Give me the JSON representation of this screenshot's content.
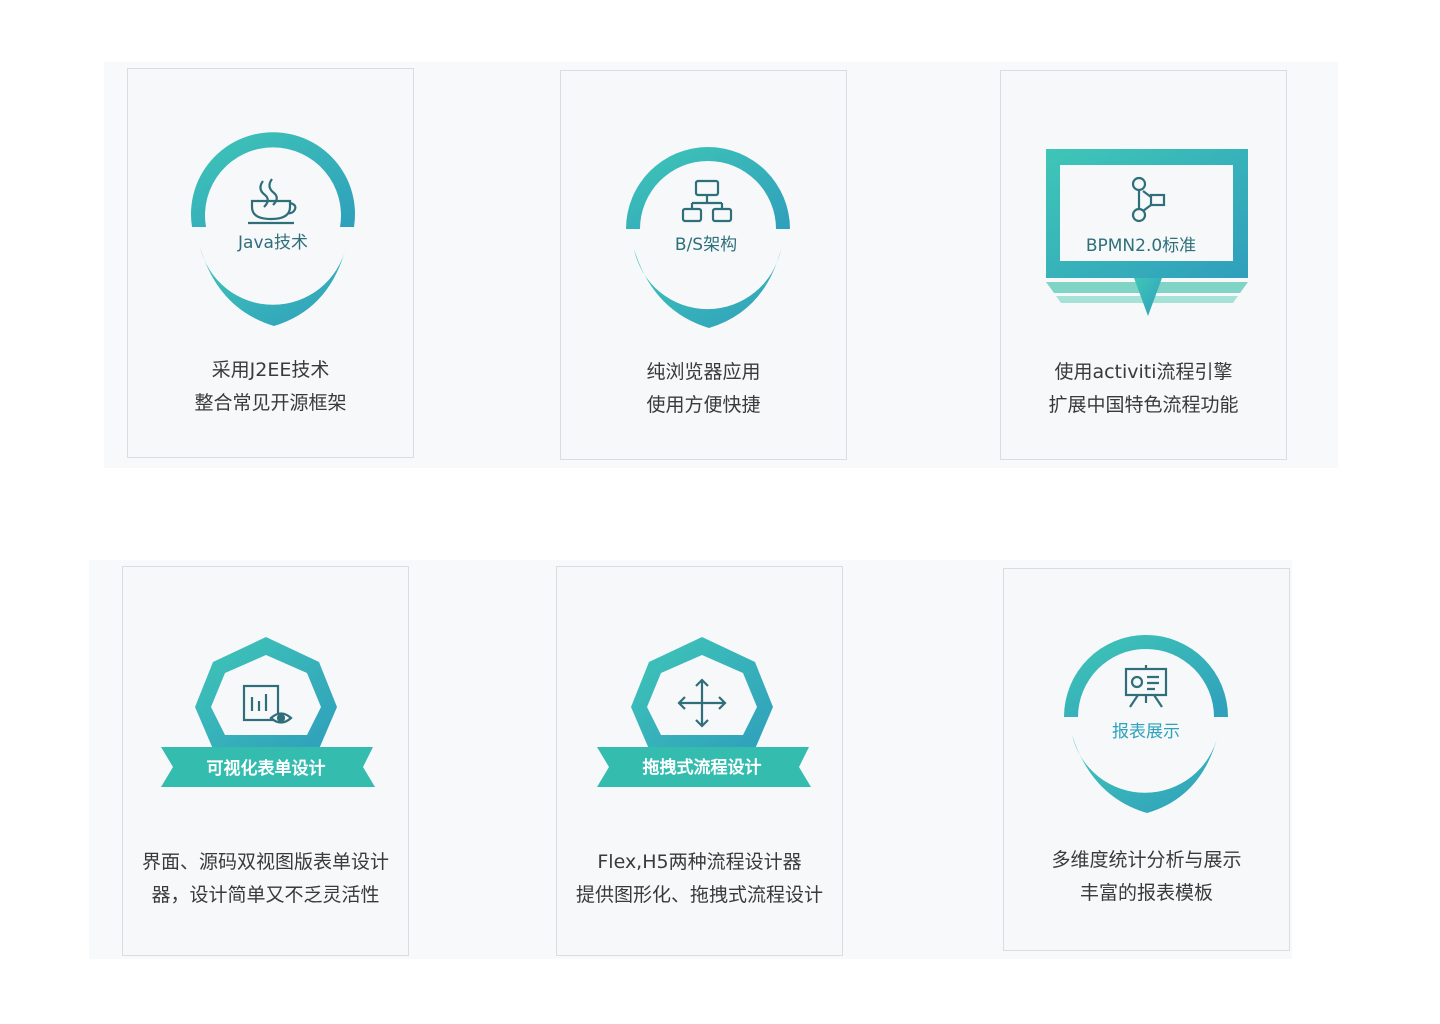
{
  "colors": {
    "teal_light": "#3fc6b7",
    "teal_dark": "#2fa2bb",
    "icon_stroke": "#2f6f7a",
    "card_bg": "#f6f8fa",
    "card_border": "#d9dde1",
    "text": "#3a3a3a"
  },
  "features": [
    {
      "icon": "java-cup-icon",
      "badge_label": "Java技术",
      "lines": [
        "采用J2EE技术",
        "整合常见开源框架"
      ]
    },
    {
      "icon": "architecture-diagram-icon",
      "badge_label": "B/S架构",
      "lines": [
        "纯浏览器应用",
        "使用方便快捷"
      ]
    },
    {
      "icon": "workflow-nodes-icon",
      "badge_label": "BPMN2.0标准",
      "lines": [
        "使用activiti流程引擎",
        "扩展中国特色流程功能"
      ]
    },
    {
      "icon": "form-view-icon",
      "badge_label": "可视化表单设计",
      "lines": [
        "界面、源码双视图版表单设计",
        "器，设计简单又不乏灵活性"
      ]
    },
    {
      "icon": "move-arrows-icon",
      "badge_label": "拖拽式流程设计",
      "lines": [
        "Flex,H5两种流程设计器",
        "提供图形化、拖拽式流程设计"
      ]
    },
    {
      "icon": "presentation-board-icon",
      "badge_label": "报表展示",
      "lines": [
        "多维度统计分析与展示",
        "丰富的报表模板"
      ]
    }
  ]
}
